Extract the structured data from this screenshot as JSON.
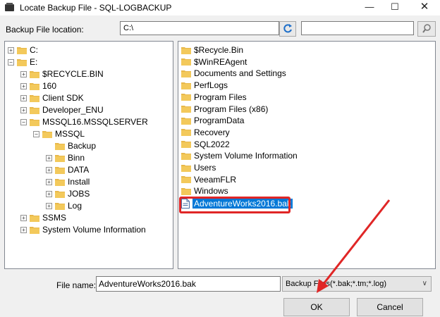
{
  "window": {
    "title": "Locate Backup File - SQL-LOGBACKUP",
    "minimize_glyph": "—",
    "maximize_glyph": "☐",
    "close_glyph": "✕"
  },
  "location": {
    "label": "Backup File location:",
    "value": "C:\\",
    "search_value": ""
  },
  "icons": {
    "refresh": "refresh-icon",
    "search": "search-icon",
    "folder": "folder-icon",
    "file": "backup-file-icon"
  },
  "tree": [
    {
      "label": "C:",
      "expander": "+"
    },
    {
      "label": "E:",
      "expander": "−"
    },
    {
      "label": "$RECYCLE.BIN",
      "expander": "+"
    },
    {
      "label": "160",
      "expander": "+"
    },
    {
      "label": "Client SDK",
      "expander": "+"
    },
    {
      "label": "Developer_ENU",
      "expander": "+"
    },
    {
      "label": "MSSQL16.MSSQLSERVER",
      "expander": "−"
    },
    {
      "label": "MSSQL",
      "expander": "−"
    },
    {
      "label": "Backup",
      "expander": ""
    },
    {
      "label": "Binn",
      "expander": "+"
    },
    {
      "label": "DATA",
      "expander": "+"
    },
    {
      "label": "Install",
      "expander": "+"
    },
    {
      "label": "JOBS",
      "expander": "+"
    },
    {
      "label": "Log",
      "expander": "+"
    },
    {
      "label": "SSMS",
      "expander": "+"
    },
    {
      "label": "System Volume Information",
      "expander": "+"
    }
  ],
  "list": [
    "$Recycle.Bin",
    "$WinREAgent",
    "Documents and Settings",
    "PerfLogs",
    "Program Files",
    "Program Files (x86)",
    "ProgramData",
    "Recovery",
    "SQL2022",
    "System Volume Information",
    "Users",
    "VeeamFLR",
    "Windows"
  ],
  "selected_file": "AdventureWorks2016.bak",
  "file_name": {
    "label": "File name:",
    "value": "AdventureWorks2016.bak"
  },
  "file_type": {
    "value": "Backup Files(*.bak;*.tm;*.log)"
  },
  "buttons": {
    "ok": "OK",
    "cancel": "Cancel"
  },
  "colors": {
    "highlight": "#e02626",
    "selection": "#0078d7",
    "folder": "#e8b84a"
  }
}
